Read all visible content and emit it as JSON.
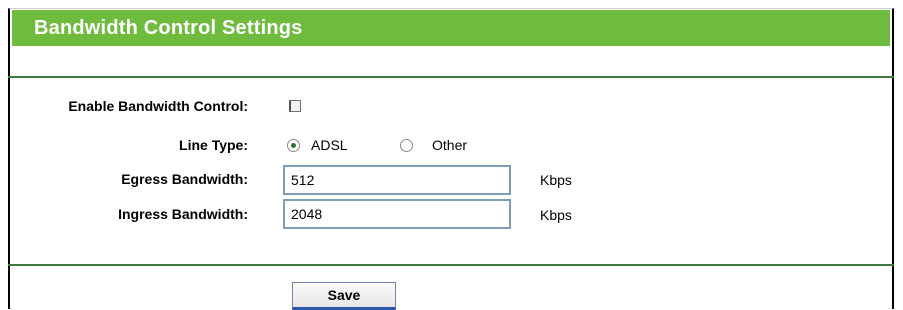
{
  "page": {
    "title": "Bandwidth Control Settings"
  },
  "form": {
    "enable_label": "Enable Bandwidth Control:",
    "enable_checked": false,
    "line_type_label": "Line Type:",
    "line_type_options": [
      "ADSL",
      "Other"
    ],
    "line_type_selected": "ADSL",
    "egress_label": "Egress Bandwidth:",
    "egress_value": "512",
    "egress_unit": "Kbps",
    "ingress_label": "Ingress Bandwidth:",
    "ingress_value": "2048",
    "ingress_unit": "Kbps"
  },
  "actions": {
    "save_label": "Save"
  },
  "colors": {
    "title_bar": "#6ebb3e",
    "divider": "#3d7a3d"
  }
}
